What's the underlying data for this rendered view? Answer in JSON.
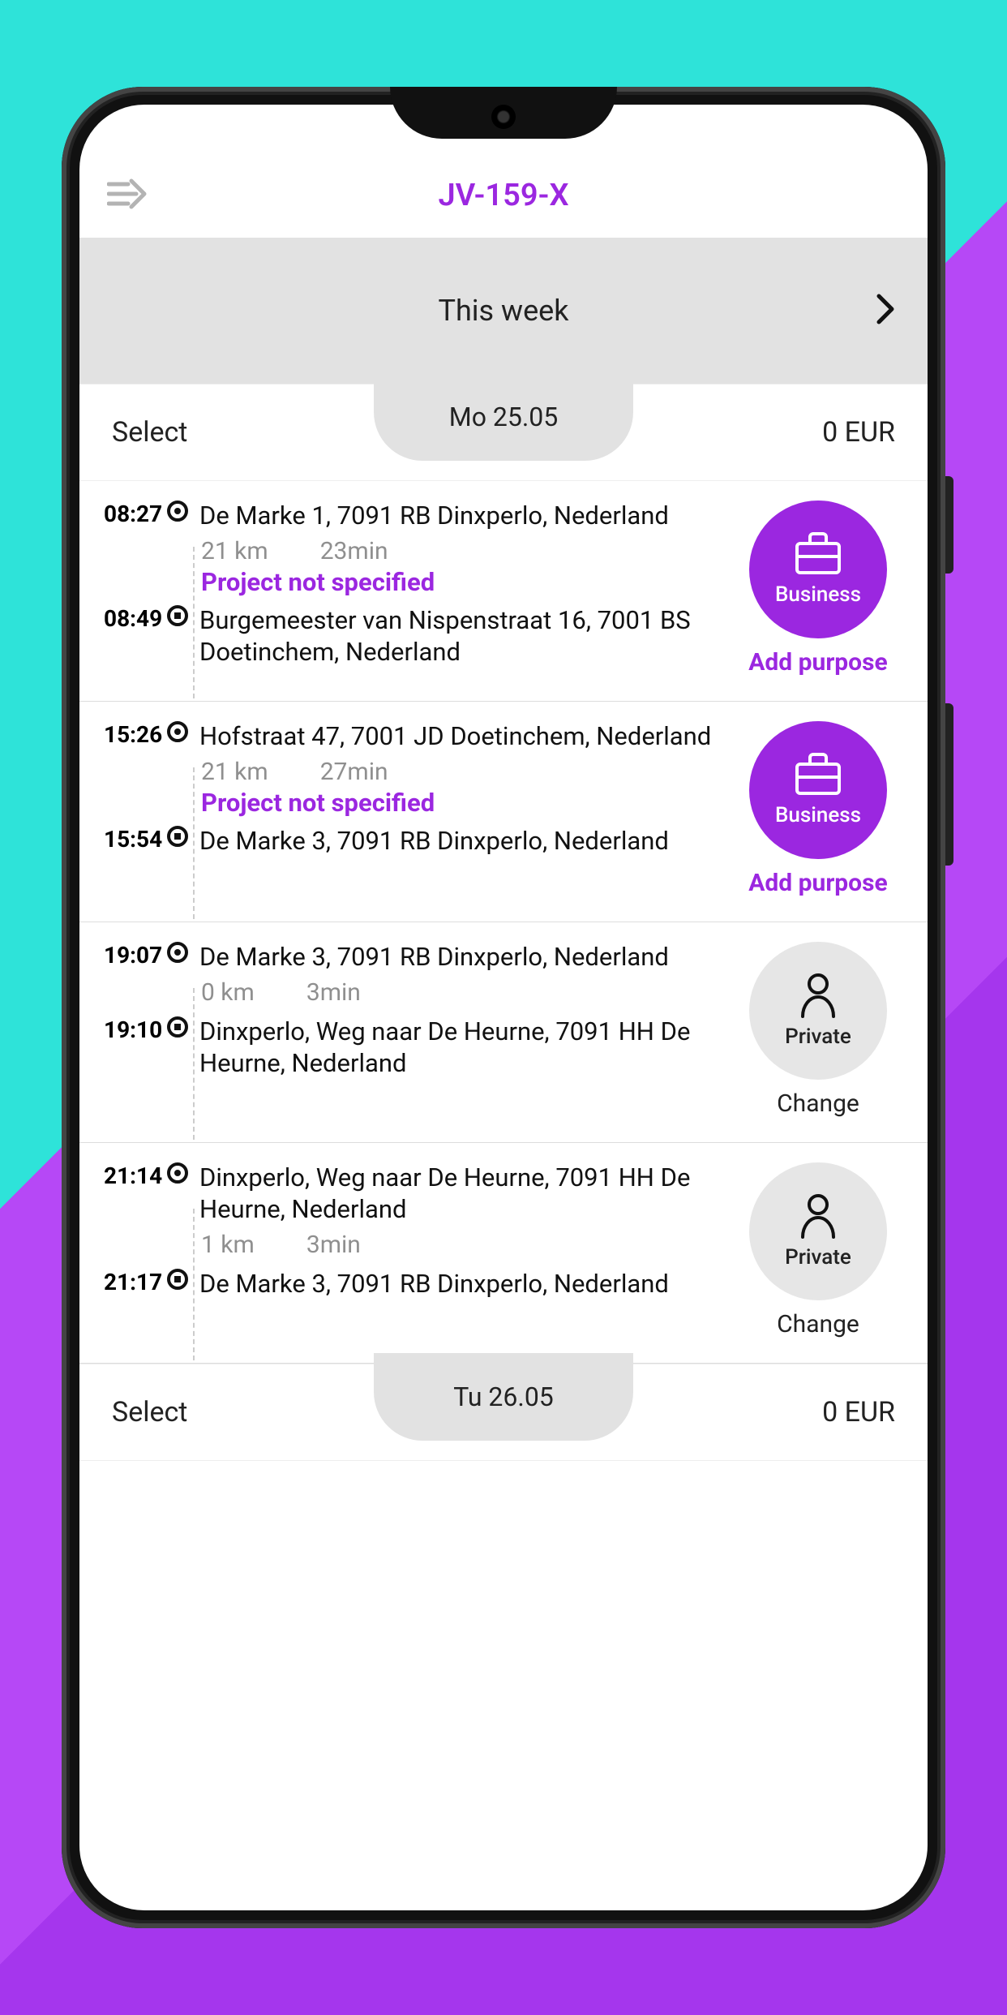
{
  "header": {
    "title": "JV-159-X"
  },
  "week": {
    "label": "This week"
  },
  "days": [
    {
      "select_label": "Select",
      "date_label": "Mo 25.05",
      "amount": "0 EUR",
      "trips": [
        {
          "start_time": "08:27",
          "end_time": "08:49",
          "start_addr": "De Marke 1, 7091 RB Dinxperlo, Nederland",
          "end_addr": "Burgemeester van Nispenstraat 16, 7001 BS Doetinchem, Nederland",
          "distance": "21 km",
          "duration": "23min",
          "project": "Project not specified",
          "category": "Business",
          "category_type": "business",
          "action": "Add purpose",
          "action_style": "accent"
        },
        {
          "start_time": "15:26",
          "end_time": "15:54",
          "start_addr": "Hofstraat 47, 7001 JD Doetinchem, Nederland",
          "end_addr": "De Marke 3, 7091 RB Dinxperlo, Nederland",
          "distance": "21 km",
          "duration": "27min",
          "project": "Project not specified",
          "category": "Business",
          "category_type": "business",
          "action": "Add purpose",
          "action_style": "accent"
        },
        {
          "start_time": "19:07",
          "end_time": "19:10",
          "start_addr": "De Marke 3, 7091 RB Dinxperlo, Nederland",
          "end_addr": "Dinxperlo, Weg naar De Heurne, 7091 HH De Heurne, Nederland",
          "distance": "0 km",
          "duration": "3min",
          "project": "",
          "category": "Private",
          "category_type": "private",
          "action": "Change",
          "action_style": "plain"
        },
        {
          "start_time": "21:14",
          "end_time": "21:17",
          "start_addr": "Dinxperlo, Weg naar De Heurne, 7091 HH De Heurne, Nederland",
          "end_addr": "De Marke 3, 7091 RB Dinxperlo, Nederland",
          "distance": "1 km",
          "duration": "3min",
          "project": "",
          "category": "Private",
          "category_type": "private",
          "action": "Change",
          "action_style": "plain"
        }
      ]
    },
    {
      "select_label": "Select",
      "date_label": "Tu 26.05",
      "amount": "0 EUR",
      "trips": []
    }
  ]
}
